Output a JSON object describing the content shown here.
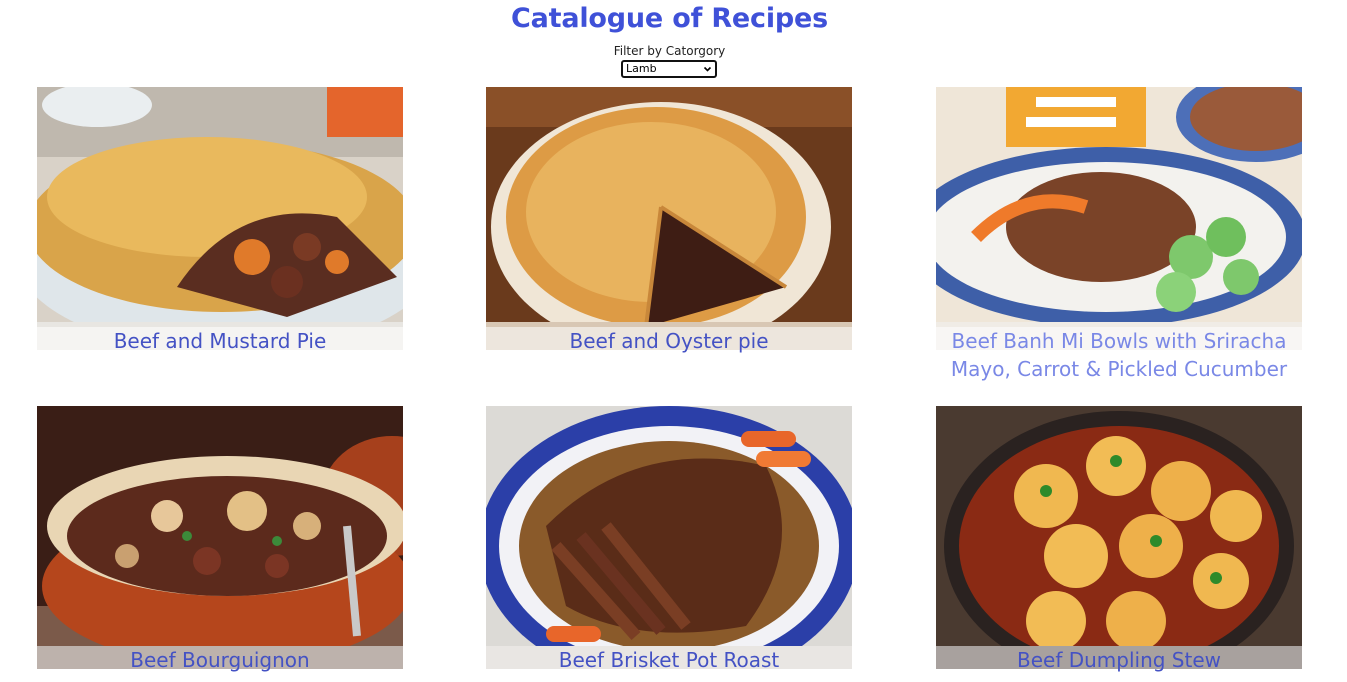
{
  "header": {
    "title": "Catalogue of Recipes",
    "filter_label": "Filter by Catorgory",
    "filter_selected": "Lamb"
  },
  "recipes": [
    {
      "name": "Beef and Mustard Pie",
      "image": "pie-with-stew-image"
    },
    {
      "name": "Beef and Oyster pie",
      "image": "pie-with-slice-removed-image"
    },
    {
      "name": "Beef Banh Mi Bowls with Sriracha Mayo, Carrot & Pickled Cucumber",
      "image": "rice-bowl-image"
    },
    {
      "name": "Beef Bourguignon",
      "image": "casserole-dish-image"
    },
    {
      "name": "Beef Brisket Pot Roast",
      "image": "sliced-brisket-image"
    },
    {
      "name": "Beef Dumpling Stew",
      "image": "dumpling-stew-pan-image"
    }
  ],
  "colors": {
    "title": "#3f51d8",
    "caption": "#4452c4"
  }
}
